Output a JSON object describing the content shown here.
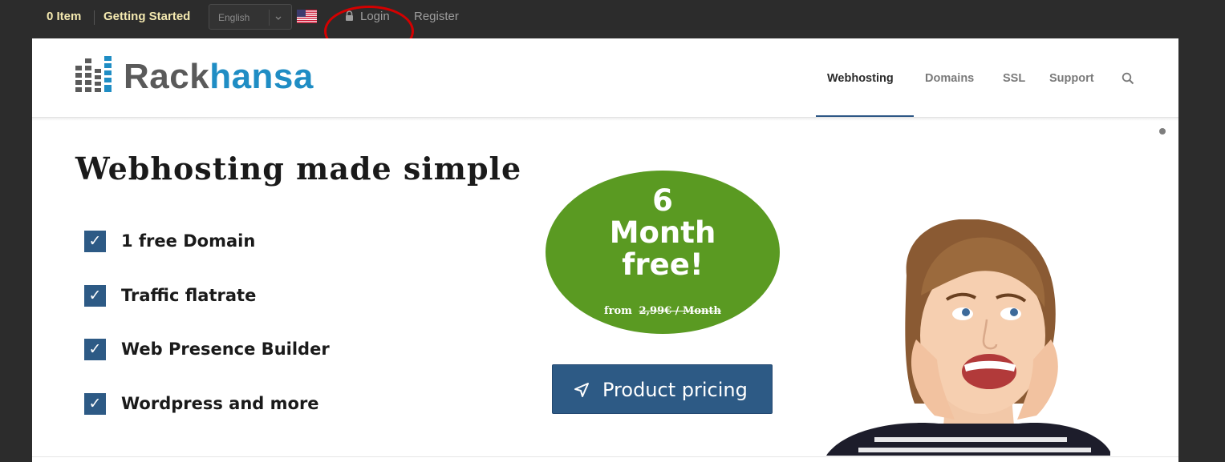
{
  "topbar": {
    "cart": "0 Item",
    "getting_started": "Getting Started",
    "language": "English",
    "login": "Login",
    "register": "Register"
  },
  "logo": {
    "part1": "Rack",
    "part2": "hansa"
  },
  "nav": {
    "items": [
      {
        "label": "Webhosting",
        "active": true
      },
      {
        "label": "Domains",
        "active": false
      },
      {
        "label": "SSL",
        "active": false
      },
      {
        "label": "Support",
        "active": false
      }
    ]
  },
  "hero": {
    "title": "Webhosting made simple",
    "features": [
      "1 free Domain",
      "Traffic flatrate",
      "Web Presence Builder",
      "Wordpress and more"
    ],
    "check_glyph": "✓",
    "badge": {
      "line1": "6",
      "line2": "Month",
      "line3": "free!",
      "from_label": "from",
      "old_price": "2,99€ / Month"
    },
    "pricing_button": "Product pricing"
  },
  "colors": {
    "accent_blue": "#2d5a85",
    "logo_blue": "#1f8dc4",
    "badge_green": "#5a9a22",
    "annotation_red": "#d40000"
  },
  "icons": [
    "lock-icon",
    "search-icon",
    "paper-plane-icon",
    "us-flag-icon",
    "chevron-down-icon"
  ]
}
